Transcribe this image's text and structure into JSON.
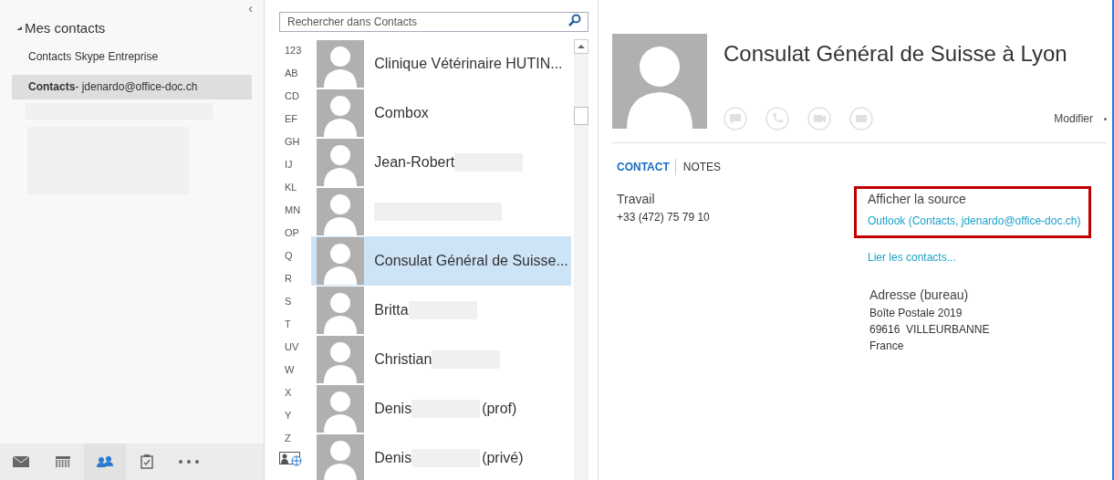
{
  "sidebar": {
    "collapse_glyph": "‹",
    "section": {
      "title": "Mes contacts",
      "expanded": true,
      "items": [
        {
          "label": "Contacts Skype Entreprise",
          "selected": false
        },
        {
          "label": "Contacts",
          "suffix": " - jdenardo@office-doc.ch",
          "selected": true
        }
      ]
    },
    "nav": [
      {
        "kind": "mail",
        "selected": false
      },
      {
        "kind": "calendar",
        "selected": false
      },
      {
        "kind": "people",
        "selected": true
      },
      {
        "kind": "tasks",
        "selected": false
      },
      {
        "kind": "more",
        "selected": false
      }
    ]
  },
  "search": {
    "placeholder": "Rechercher dans Contacts"
  },
  "index": [
    "123",
    "AB",
    "CD",
    "EF",
    "GH",
    "IJ",
    "KL",
    "MN",
    "OP",
    "Q",
    "R",
    "S",
    "T",
    "UV",
    "W",
    "X",
    "Y",
    "Z"
  ],
  "contacts": [
    {
      "name": "Clinique Vétérinaire HUTIN...",
      "redacted": false,
      "selected": false
    },
    {
      "name": "Combox",
      "redacted": false,
      "selected": false
    },
    {
      "name": "Jean-Robert",
      "redacted": true,
      "selected": false
    },
    {
      "redacted": true,
      "selected": false
    },
    {
      "name": "Consulat Général de Suisse...",
      "redacted": false,
      "selected": true
    },
    {
      "name": "Britta",
      "redacted": true,
      "selected": false
    },
    {
      "name": "Christian",
      "redacted": true,
      "selected": false
    },
    {
      "name": "Denis",
      "redacted": true,
      "suffix": "(prof)",
      "selected": false
    },
    {
      "name": "Denis",
      "redacted": true,
      "suffix": "(privé)",
      "selected": false
    }
  ],
  "detail": {
    "name": "Consulat Général de Suisse à Lyon",
    "edit": "Modifier",
    "tabs": [
      {
        "label": "CONTACT",
        "selected": true
      },
      {
        "label": "NOTES",
        "selected": false
      }
    ],
    "phone": {
      "label": "Travail",
      "value": "+33 (472) 75 79 10"
    },
    "source": {
      "label": "Afficher la source",
      "link": "Outlook (Contacts, jdenardo@office-doc.ch)",
      "highlighted": true
    },
    "link_contacts": "Lier les contacts...",
    "address": {
      "label": "Adresse (bureau)",
      "lines": [
        "Boîte Postale 2019",
        "69616  VILLEURBANNE",
        "France"
      ]
    }
  }
}
